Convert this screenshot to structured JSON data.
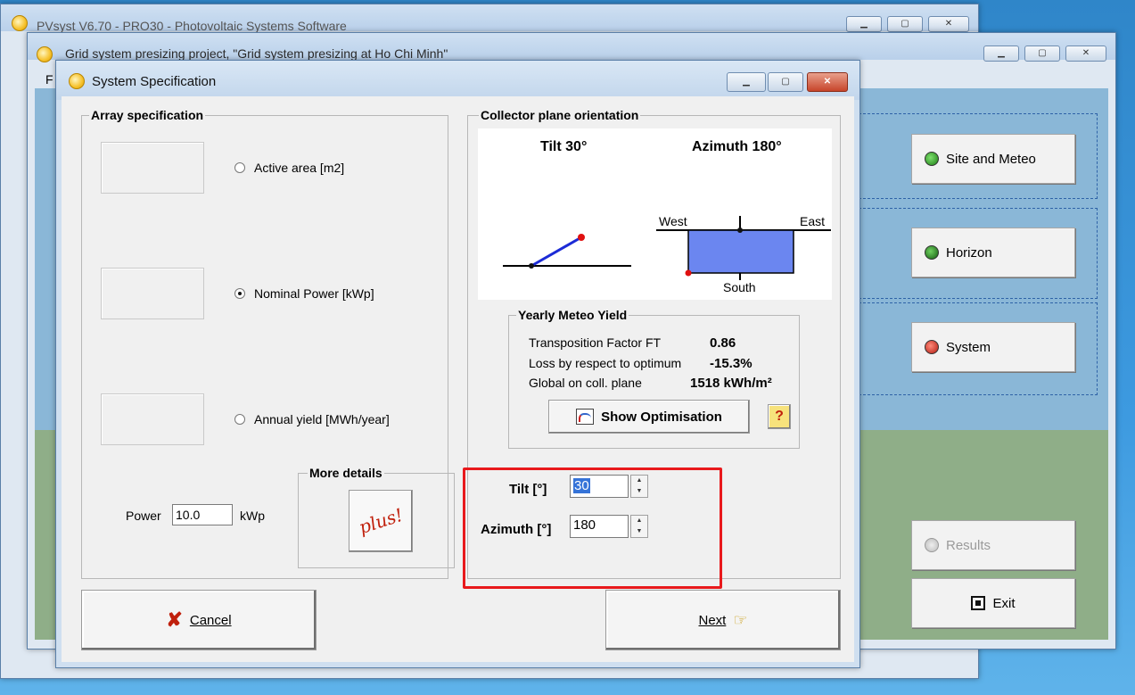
{
  "windows": {
    "main_title": "PVsyst V6.70 - PRO30 - Photovoltaic Systems Software",
    "project_title": "Grid system presizing project, \"Grid system presizing  at  Ho Chi Minh\"",
    "dialog_title": "System Specification"
  },
  "project_menu_letter": "F",
  "project_buttons": {
    "site_meteo": "Site and Meteo",
    "horizon": "Horizon",
    "system": "System",
    "results": "Results",
    "exit": "Exit"
  },
  "array_spec": {
    "title": "Array specification",
    "options": [
      {
        "label": "Active area [m2]",
        "selected": false
      },
      {
        "label": "Nominal Power [kWp]",
        "selected": true
      },
      {
        "label": "Annual yield [MWh/year]",
        "selected": false
      }
    ],
    "power_label": "Power",
    "power_value": "10.0",
    "power_unit": "kWp",
    "more_details_title": "More details",
    "plus_label": "plus!"
  },
  "orientation": {
    "title": "Collector plane orientation",
    "tilt_caption": "Tilt 30°",
    "azimuth_caption": "Azimuth 180°",
    "west": "West",
    "east": "East",
    "south": "South"
  },
  "yield": {
    "title": "Yearly Meteo Yield",
    "rows": [
      {
        "label": "Transposition Factor FT",
        "value": "0.86"
      },
      {
        "label": "Loss by respect to optimum",
        "value": "-15.3%"
      },
      {
        "label": "Global  on coll. plane",
        "value": "1518 kWh/m²"
      }
    ],
    "show_opt_label": "Show Optimisation",
    "help_label": "?"
  },
  "inputs": {
    "tilt_label": "Tilt [°]",
    "tilt_value": "30",
    "azimuth_label": "Azimuth [°]",
    "azimuth_value": "180"
  },
  "footer": {
    "cancel_label": "Cancel",
    "next_label": "Next"
  },
  "colors": {
    "highlight_box": "#e8191c",
    "plane_fill": "#6b86f0",
    "tilt_line": "#1c2bd6",
    "marker": "#e01010",
    "cancel_x": "#c0200c"
  }
}
